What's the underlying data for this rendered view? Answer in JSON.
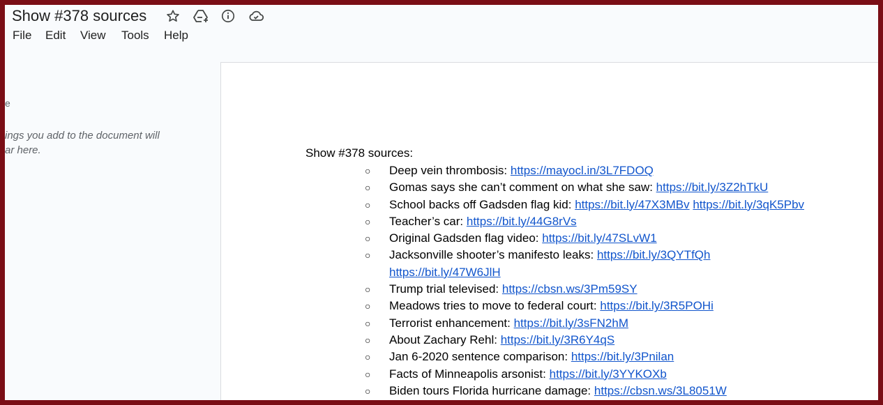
{
  "document": {
    "title": "Show #378 sources"
  },
  "menu": {
    "file": "File",
    "edit": "Edit",
    "view": "View",
    "tools": "Tools",
    "help": "Help"
  },
  "outline_panel": {
    "heading_fragment": "e",
    "hint_line1": "ings you add to the document will",
    "hint_line2": "ar here."
  },
  "body": {
    "heading": "Show #378 sources:",
    "bullet_char": "○",
    "items": [
      {
        "text": "Deep vein thrombosis: ",
        "links": [
          "https://mayocl.in/3L7FDOQ"
        ]
      },
      {
        "text": "Gomas says she can’t comment on what she saw: ",
        "links": [
          "https://bit.ly/3Z2hTkU"
        ]
      },
      {
        "text": "School backs off Gadsden flag kid: ",
        "links": [
          "https://bit.ly/47X3MBv",
          "https://bit.ly/3qK5Pbv"
        ]
      },
      {
        "text": "Teacher’s car: ",
        "links": [
          "https://bit.ly/44G8rVs"
        ]
      },
      {
        "text": "Original Gadsden flag video: ",
        "links": [
          "https://bit.ly/47SLvW1"
        ]
      },
      {
        "text": "Jacksonville shooter’s manifesto leaks: ",
        "links": [
          "https://bit.ly/3QYTfQh"
        ],
        "continuation_links": [
          "https://bit.ly/47W6JlH"
        ]
      },
      {
        "text": "Trump trial televised: ",
        "links": [
          "https://cbsn.ws/3Pm59SY"
        ]
      },
      {
        "text": "Meadows tries to move to federal court: ",
        "links": [
          "https://bit.ly/3R5POHi"
        ]
      },
      {
        "text": "Terrorist enhancement: ",
        "links": [
          "https://bit.ly/3sFN2hM"
        ]
      },
      {
        "text": "About Zachary Rehl: ",
        "links": [
          "https://bit.ly/3R6Y4qS"
        ]
      },
      {
        "text": "Jan 6-2020 sentence comparison: ",
        "links": [
          "https://bit.ly/3Pnilan"
        ]
      },
      {
        "text": "Facts of Minneapolis arsonist: ",
        "links": [
          "https://bit.ly/3YYKOXb"
        ]
      },
      {
        "text": "Biden tours Florida hurricane damage: ",
        "links": [
          "https://cbsn.ws/3L8051W"
        ]
      }
    ]
  },
  "icons": {
    "star": "star-icon",
    "add_to_drive": "add-to-drive-icon",
    "info": "info-icon",
    "cloud_status": "cloud-saved-icon"
  },
  "colors": {
    "link": "#1155cc",
    "border": "#7a0e16",
    "chrome_bg": "#f9fbfd"
  }
}
